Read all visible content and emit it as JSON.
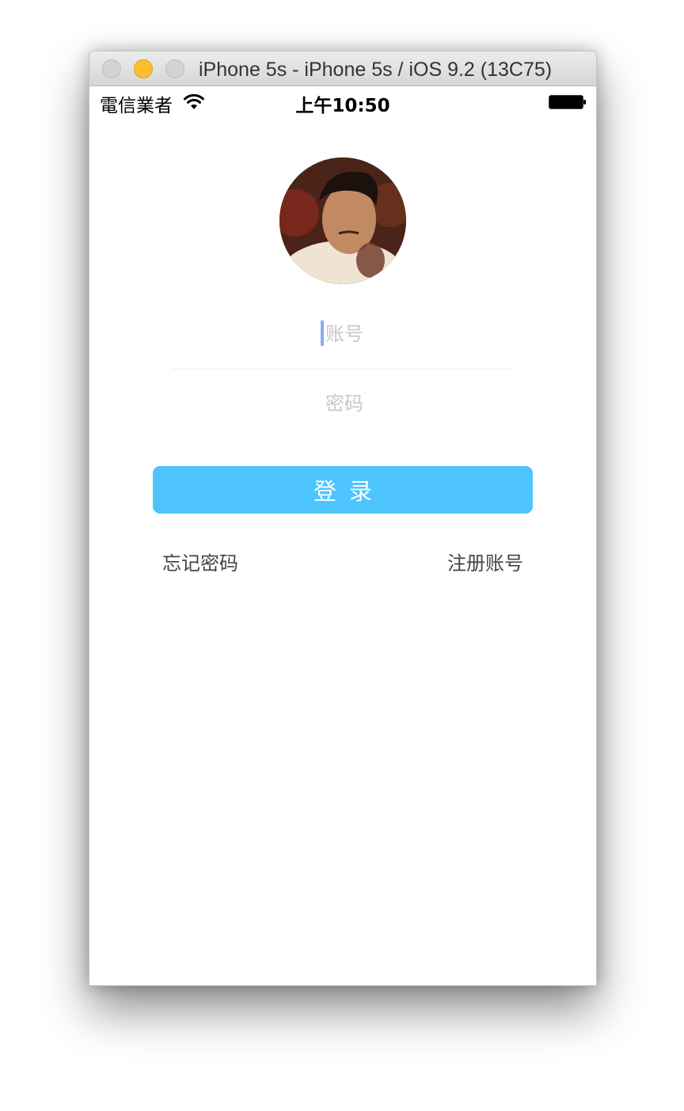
{
  "window": {
    "title": "iPhone 5s - iPhone 5s / iOS 9.2 (13C75)"
  },
  "status_bar": {
    "carrier": "電信業者",
    "time": "上午10:50",
    "icons": [
      "wifi-icon",
      "battery-icon"
    ]
  },
  "login": {
    "account_placeholder": "账号",
    "account_value": "",
    "password_placeholder": "密码",
    "password_value": "",
    "login_label": "登录",
    "forgot_password_label": "忘记密码",
    "register_label": "注册账号"
  },
  "colors": {
    "accent": "#4DC4FE",
    "cursor": "#8AA9F5",
    "placeholder": "#C7C7CD",
    "traffic_minimize": "#FCBE2F"
  }
}
